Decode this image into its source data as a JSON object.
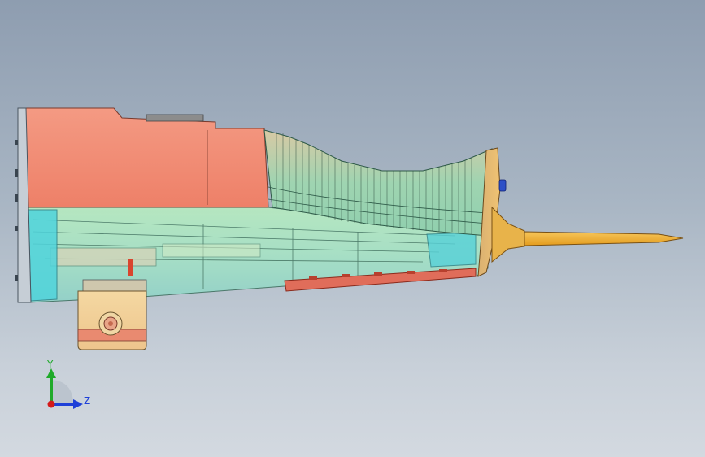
{
  "viewport": {
    "background_top": "#8e9db0",
    "background_bottom": "#d3d9e0"
  },
  "model": {
    "parts": [
      "housing-top-shell",
      "transparent-body",
      "ribbed-grip",
      "front-collar",
      "probe-tip",
      "connector-block",
      "bottom-circuit-board",
      "end-cap"
    ],
    "colors": {
      "shell": "#f08b73",
      "transparent_body": "#9fe0c6",
      "cyan_parts": "#4fd4dc",
      "tan_parts": "#e9cf9a",
      "orange_probe": "#f2b233",
      "blue_button": "#2c4fc7"
    }
  },
  "triad": {
    "y_label": "Y",
    "z_label": "Z",
    "y_color": "#1faa2a",
    "z_color": "#1e40d8",
    "x_color": "#d41a1a"
  }
}
